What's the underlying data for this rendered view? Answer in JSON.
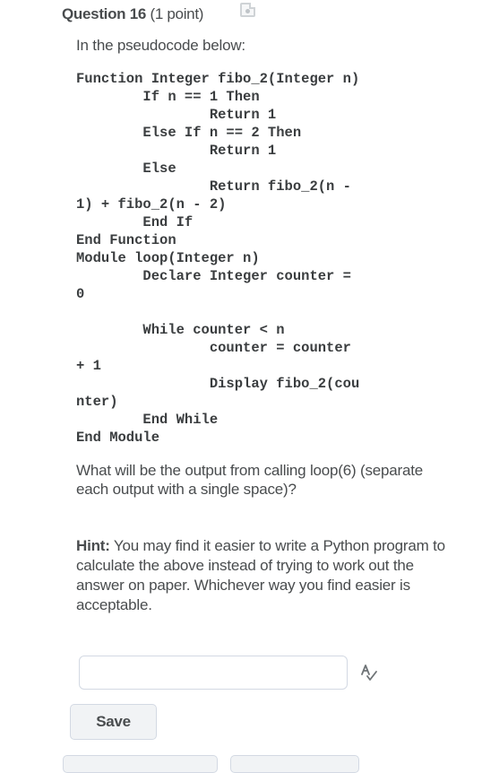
{
  "question": {
    "number_label": "Question 16",
    "points_label": "(1 point)",
    "intro": "In the pseudocode below:",
    "code_function": "Function Integer fibo_2(Integer n)\n        If n == 1 Then\n                Return 1\n        Else If n == 2 Then\n                Return 1\n        Else\n                Return fibo_2(n -\n1) + fibo_2(n - 2)\n        End If\nEnd Function",
    "code_module": "Module loop(Integer n)\n        Declare Integer counter =\n0\n\n        While counter < n\n                counter = counter\n+ 1\n                Display fibo_2(cou\nnter)\n        End While\nEnd Module",
    "prompt": "What will be the output from calling loop(6) (separate each output with a single space)?",
    "hint_label": "Hint:",
    "hint_text": " You may find it easier to write a Python program to calculate the above instead of trying to work out the answer on paper. Whichever way you find easier is acceptable."
  },
  "answer": {
    "value": "",
    "placeholder": ""
  },
  "actions": {
    "save_label": "Save"
  },
  "icons": {
    "flag": "save-flag-icon",
    "spellcheck": "spellcheck-icon"
  },
  "colors": {
    "text": "#494c4e",
    "border": "#d3d9e3",
    "button_bg": "#f1f3f5"
  }
}
